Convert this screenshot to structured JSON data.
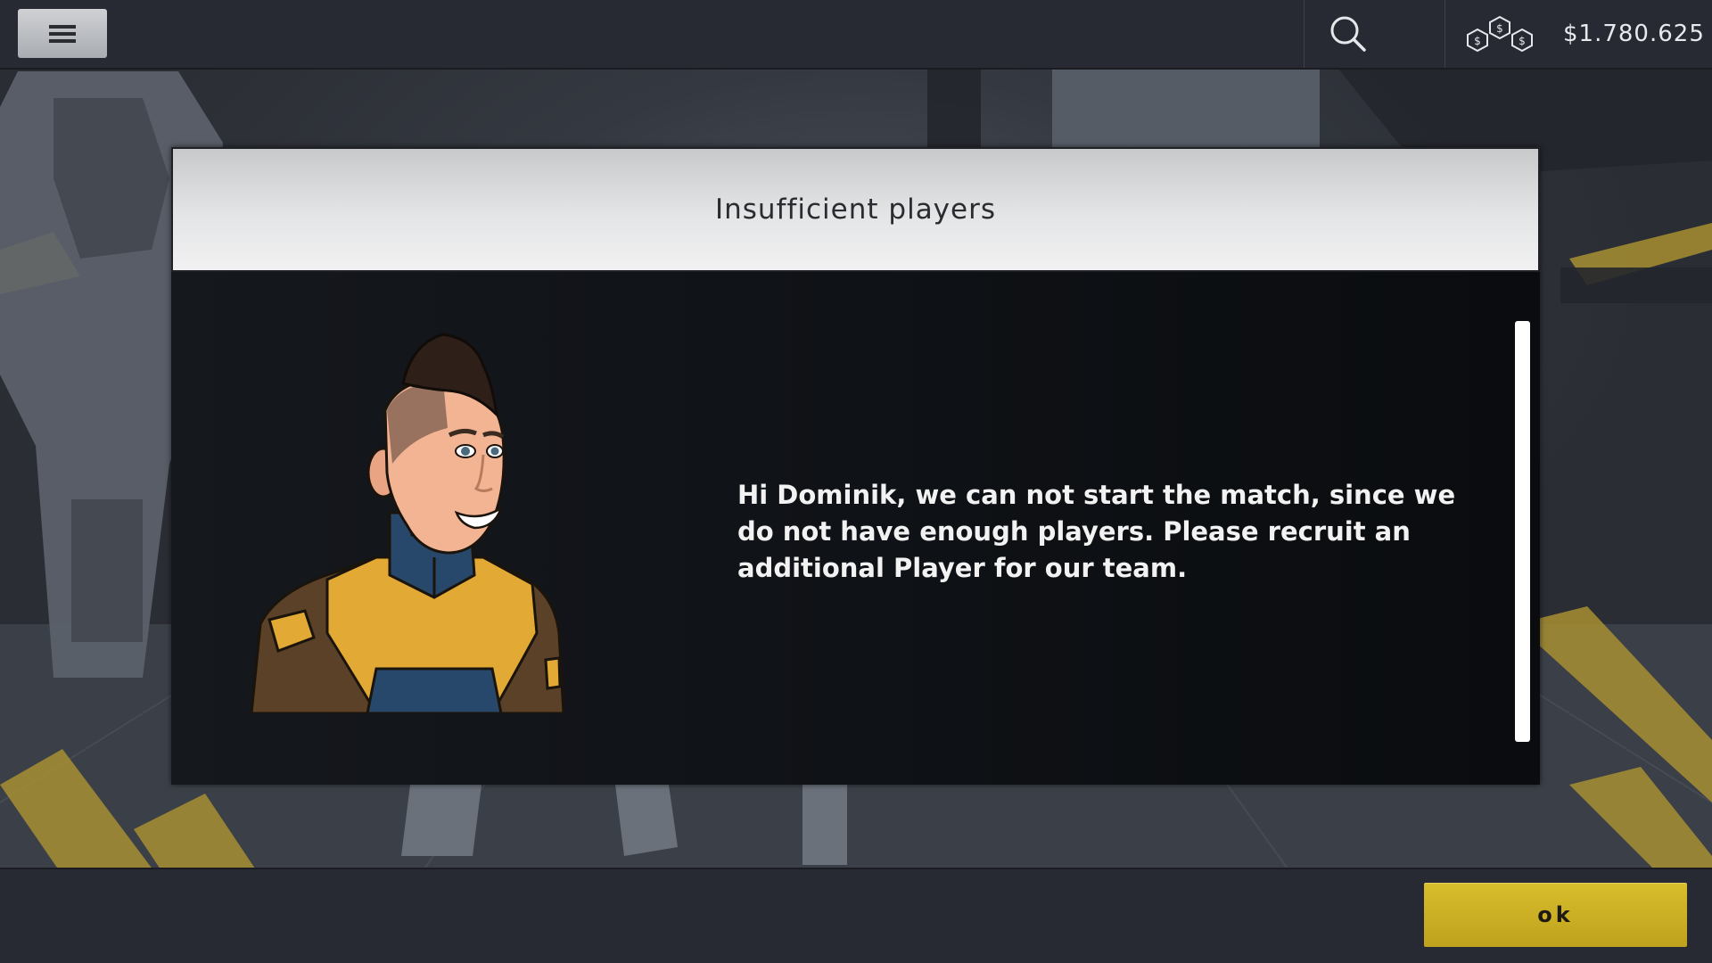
{
  "topbar": {
    "menu_icon": "hamburger-menu-icon",
    "search_icon": "search-icon",
    "currency_icon": "coins-icon",
    "balance": "$1.780.625"
  },
  "dialog": {
    "title": "Insufficient players",
    "message": "Hi Dominik, we can not start the match, since we do not have enough players. Please recruit an additional Player for our team.",
    "portrait_icon": "character-portrait"
  },
  "footer": {
    "ok_label": "Ok"
  },
  "colors": {
    "accent": "#c9ad22",
    "bar_background": "#272a33",
    "dialog_background": "#101317",
    "header_background": "#e4e5e6"
  }
}
